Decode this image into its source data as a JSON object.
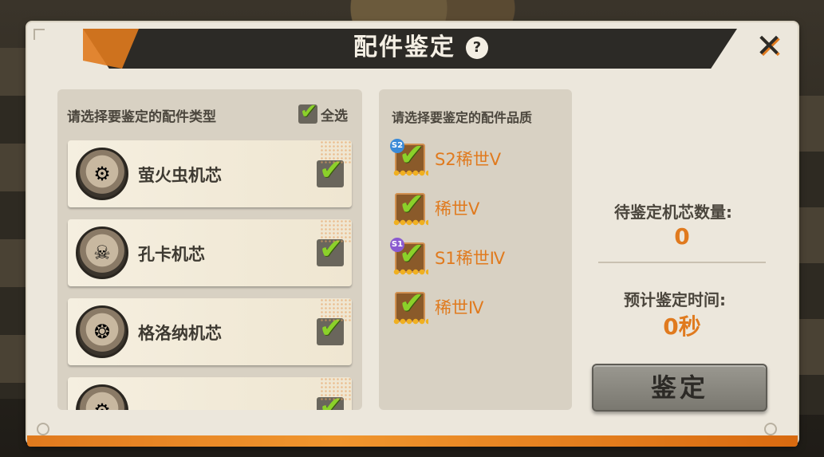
{
  "dialog": {
    "title": "配件鉴定",
    "help_glyph": "?",
    "close_glyph": "✕"
  },
  "type_panel": {
    "header": "请选择要鉴定的配件类型",
    "select_all_label": "全选",
    "select_all_checked": true,
    "items": [
      {
        "name": "萤火虫机芯",
        "checked": true,
        "icon": "firefly-robot-icon"
      },
      {
        "name": "孔卡机芯",
        "checked": true,
        "icon": "pirate-robot-icon"
      },
      {
        "name": "格洛纳机芯",
        "checked": true,
        "icon": "red-robot-icon"
      },
      {
        "name": "",
        "checked": true,
        "icon": "robot-icon"
      }
    ]
  },
  "quality_panel": {
    "header": "请选择要鉴定的配件品质",
    "items": [
      {
        "label": "S2稀世Ⅴ",
        "badge": "S2",
        "checked": true
      },
      {
        "label": "稀世Ⅴ",
        "badge": "",
        "checked": true
      },
      {
        "label": "S1稀世Ⅳ",
        "badge": "S1",
        "checked": true
      },
      {
        "label": "稀世Ⅳ",
        "badge": "",
        "checked": true
      }
    ]
  },
  "summary": {
    "pending_label": "待鉴定机芯数量:",
    "pending_value": "0",
    "time_label": "预计鉴定时间:",
    "time_value": "0秒"
  },
  "actions": {
    "identify_label": "鉴定"
  },
  "colors": {
    "accent": "#e07a1e",
    "check_green": "#8bd12a",
    "panel_bg": "#ece7dc"
  }
}
